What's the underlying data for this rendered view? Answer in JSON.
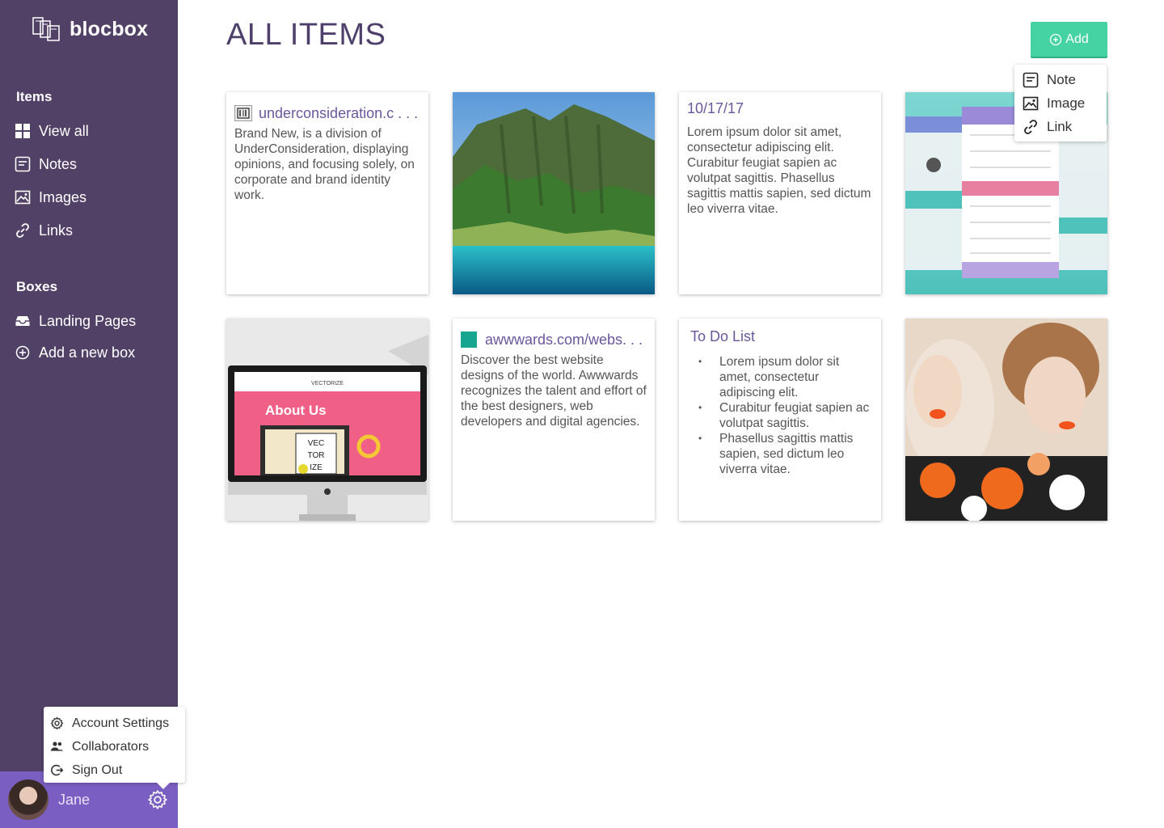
{
  "app": {
    "name": "blocbox"
  },
  "sidebar": {
    "items_heading": "Items",
    "items": [
      {
        "label": "View all",
        "icon": "grid-icon"
      },
      {
        "label": "Notes",
        "icon": "note-icon"
      },
      {
        "label": "Images",
        "icon": "image-icon"
      },
      {
        "label": "Links",
        "icon": "link-icon"
      }
    ],
    "boxes_heading": "Boxes",
    "boxes": [
      {
        "label": "Landing Pages",
        "icon": "inbox-icon"
      },
      {
        "label": "Add a new box",
        "icon": "plus-circle-icon"
      }
    ]
  },
  "user": {
    "name": "Jane"
  },
  "account_menu": {
    "items": [
      {
        "label": "Account Settings",
        "icon": "gear-icon"
      },
      {
        "label": "Collaborators",
        "icon": "people-icon"
      },
      {
        "label": "Sign Out",
        "icon": "sign-out-icon"
      }
    ]
  },
  "main": {
    "title": "ALL ITEMS",
    "add_label": "Add",
    "add_menu": [
      {
        "label": "Note",
        "icon": "note-icon"
      },
      {
        "label": "Image",
        "icon": "image-icon"
      },
      {
        "label": "Link",
        "icon": "link-icon"
      }
    ]
  },
  "cards": {
    "link1": {
      "url": "underconsideration.c . . .",
      "text": "Brand New, is a division of UnderConsideration, displaying opinions, and focusing solely, on corporate and brand identity work."
    },
    "note1": {
      "title": "10/17/17",
      "text": "Lorem ipsum dolor sit amet, consectetur adipiscing elit. Curabitur feugiat sapien ac volutpat sagittis. Phasellus sagittis mattis sapien, sed dictum leo viverra vitae."
    },
    "link2": {
      "url": "awwwards.com/webs. . .",
      "text": "Discover the best website designs of the world. Awwwards recognizes the talent and effort of the best designers, web developers and digital agencies."
    },
    "todo": {
      "title": "To Do List",
      "items": [
        "Lorem ipsum dolor sit amet, consectetur adipiscing elit.",
        "Curabitur feugiat sapien ac volutpat sagittis.",
        "Phasellus sagittis mattis sapien, sed dictum leo viverra vitae."
      ]
    },
    "mockup": {
      "heading": "About Us",
      "logo": "VECTORIZE",
      "grid": [
        "VEC",
        "TOR",
        "IZE"
      ]
    }
  },
  "colors": {
    "sidebar": "#524166",
    "accent": "#46d3a4",
    "link": "#6b569c",
    "user_bar": "#7b5ec1"
  }
}
